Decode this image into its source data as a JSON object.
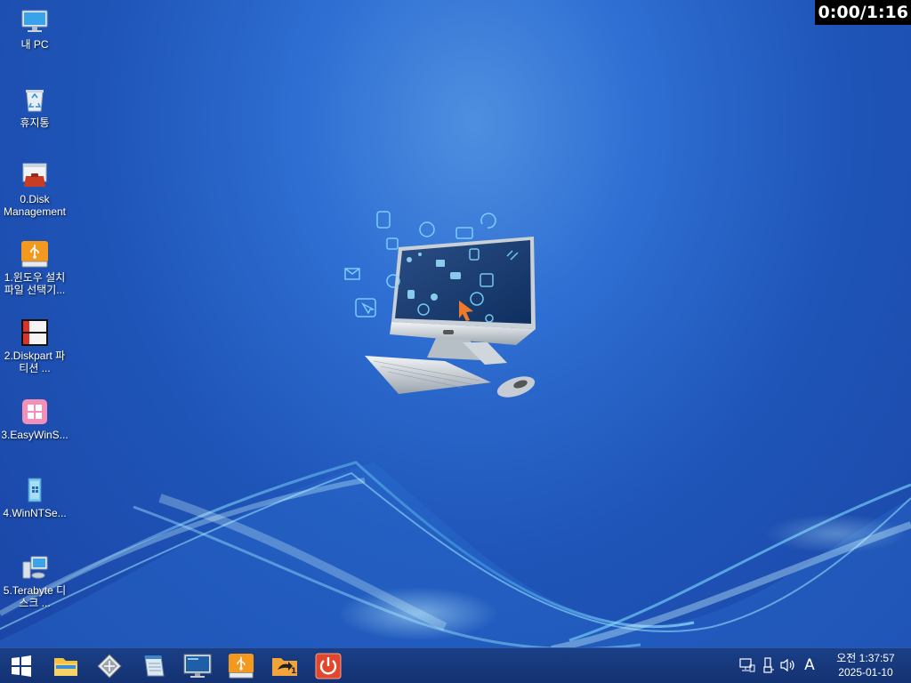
{
  "timer": "0:00/1:16",
  "desktop_icons": [
    {
      "label": "내 PC",
      "icon": "computer-icon"
    },
    {
      "label": "휴지통",
      "icon": "recycle-bin-icon"
    },
    {
      "label": "0.Disk Management",
      "icon": "toolbox-icon"
    },
    {
      "label": "1.윈도우 설치 파일 선택기...",
      "icon": "usb-installer-icon"
    },
    {
      "label": "2.Diskpart 파티션 ...",
      "icon": "partition-icon"
    },
    {
      "label": "3.EasyWinS...",
      "icon": "windows-pink-icon"
    },
    {
      "label": "4.WinNTSe...",
      "icon": "winntsetup-icon"
    },
    {
      "label": "5.Terabyte 디스크 ...",
      "icon": "terabyte-icon"
    }
  ],
  "taskbar": {
    "apps": [
      {
        "name": "start-button-icon"
      },
      {
        "name": "file-explorer-icon"
      },
      {
        "name": "disk-tool-icon"
      },
      {
        "name": "notepad-icon"
      },
      {
        "name": "monitor-icon"
      },
      {
        "name": "usb-installer-icon"
      },
      {
        "name": "backup-icon"
      },
      {
        "name": "power-icon"
      }
    ]
  },
  "tray": {
    "ime_label": "A",
    "time": "오전 1:37:57",
    "date": "2025-01-10"
  },
  "colors": {
    "desktop_blue": "#1f55b8",
    "taskbar": "#163677",
    "timer_bg": "#000000"
  }
}
